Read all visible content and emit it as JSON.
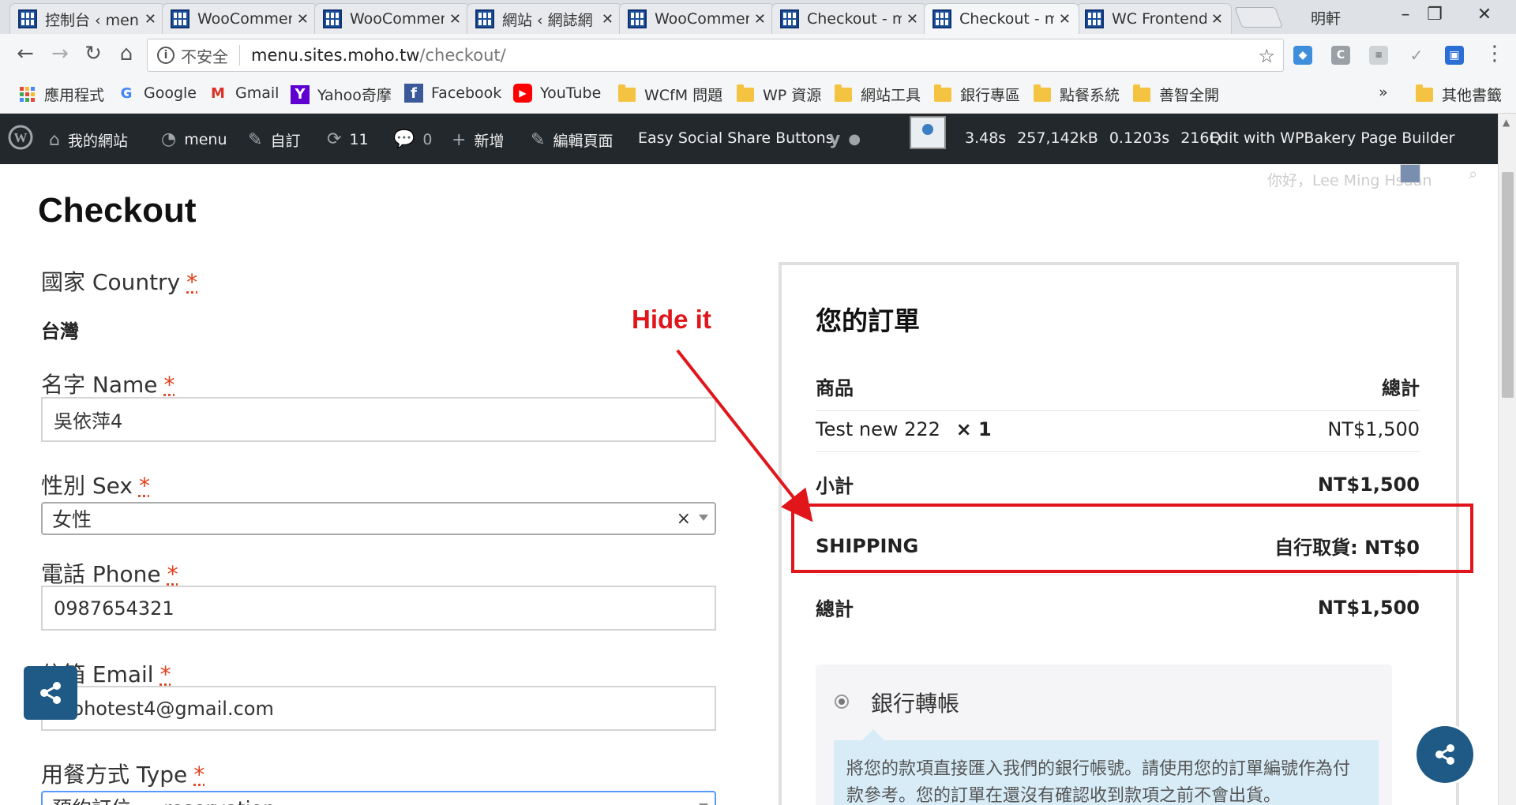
{
  "browser": {
    "tabs": [
      {
        "title": "控制台 ‹ menu"
      },
      {
        "title": "WooCommerce"
      },
      {
        "title": "WooCommerce"
      },
      {
        "title": "網站 ‹ 網誌網"
      },
      {
        "title": "WooCommerce"
      },
      {
        "title": "Checkout - m"
      },
      {
        "title": "Checkout - m"
      },
      {
        "title": "WC Frontend"
      }
    ],
    "active_tab_index": 6,
    "profile_name": "明軒",
    "address": {
      "security_label": "不安全",
      "host": "menu.sites.moho.tw",
      "path": "/checkout/"
    },
    "bookmarks": [
      {
        "label": "應用程式",
        "icon": "apps-grid-icon"
      },
      {
        "label": "Google",
        "icon": "google-icon"
      },
      {
        "label": "Gmail",
        "icon": "gmail-icon"
      },
      {
        "label": "Yahoo奇摩",
        "icon": "yahoo-icon"
      },
      {
        "label": "Facebook",
        "icon": "facebook-icon"
      },
      {
        "label": "YouTube",
        "icon": "youtube-icon"
      },
      {
        "label": "WCfM 問題",
        "icon": "folder-icon"
      },
      {
        "label": "WP 資源",
        "icon": "folder-icon"
      },
      {
        "label": "網站工具",
        "icon": "folder-icon"
      },
      {
        "label": "銀行專區",
        "icon": "folder-icon"
      },
      {
        "label": "點餐系統",
        "icon": "folder-icon"
      },
      {
        "label": "善智全開",
        "icon": "folder-icon"
      }
    ],
    "bookmarks_more": "»",
    "other_bookmarks": "其他書籤"
  },
  "adminbar": {
    "my_site": "我的網站",
    "site_name": "menu",
    "customize": "自訂",
    "updates": "11",
    "comments": "0",
    "new": "新增",
    "edit_page": "編輯頁面",
    "share_plugin": "Easy Social Share Buttons",
    "qm_time": "3.48s",
    "qm_memory": "257,142kB",
    "qm_db_time": "0.1203s",
    "qm_queries": "216Q",
    "wpbakery": "Edit with WPBakery Page Builder"
  },
  "page": {
    "greeting": "你好，Lee Ming Hsuan",
    "title": "Checkout",
    "fields": {
      "country": {
        "label": "國家 Country",
        "required": "*",
        "value": "台灣"
      },
      "name": {
        "label": "名字 Name",
        "required": "*",
        "value": "吳依萍4"
      },
      "sex": {
        "label": "性別 Sex",
        "required": "*",
        "value": "女性",
        "clear": "×"
      },
      "phone": {
        "label": "電話 Phone",
        "required": "*",
        "value": "0987654321"
      },
      "email": {
        "label": "信箱 Email",
        "required": "*",
        "value": "mohotest4@gmail.com"
      },
      "type": {
        "label": "用餐方式 Type",
        "required": "*",
        "value": "預約訂位 — reservation"
      }
    },
    "order": {
      "heading": "您的訂單",
      "col_product": "商品",
      "col_total": "總計",
      "item_name": "Test new 222",
      "item_qty": "× 1",
      "item_price": "NT$1,500",
      "subtotal_label": "小計",
      "subtotal_value": "NT$1,500",
      "shipping_label": "SHIPPING",
      "shipping_value": "自行取貨: NT$0",
      "total_label": "總計",
      "total_value": "NT$1,500"
    },
    "payment": {
      "method": "銀行轉帳",
      "description": "將您的款項直接匯入我們的銀行帳號。請使用您的訂單編號作為付款參考。您的訂單在還沒有確認收到款項之前不會出貨。"
    },
    "annotation": {
      "text": "Hide it",
      "color": "#e0161b"
    }
  }
}
